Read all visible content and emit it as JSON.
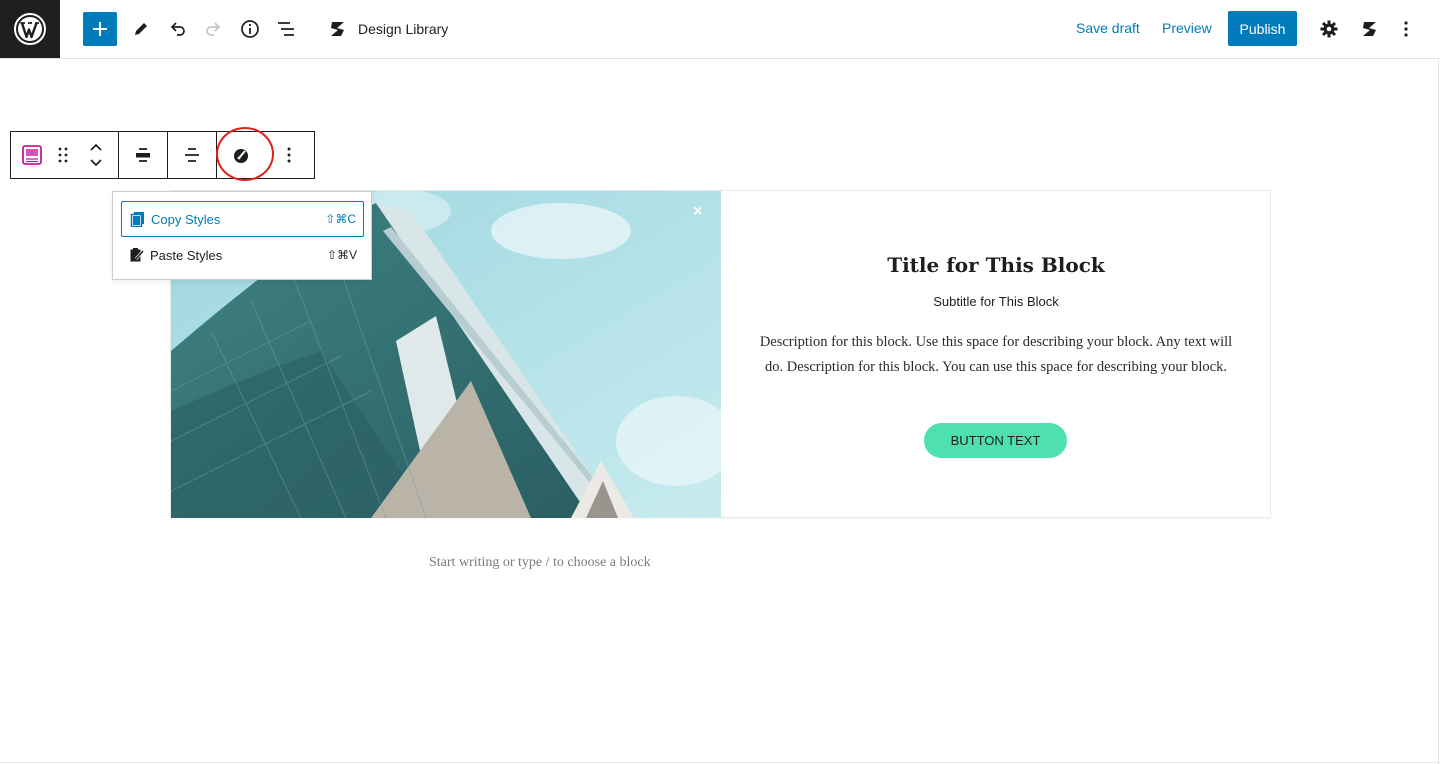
{
  "header": {
    "document_title": "Design Library",
    "save_draft": "Save draft",
    "preview": "Preview",
    "publish": "Publish"
  },
  "block_toolbar": {
    "icons": [
      "block-type-icon",
      "drag-handle-icon",
      "move-up-icon",
      "move-down-icon",
      "align-icon",
      "justify-icon",
      "styles-icon",
      "more-options-icon"
    ]
  },
  "styles_menu": {
    "items": [
      {
        "label": "Copy Styles",
        "shortcut": "⇧⌘C",
        "active": true
      },
      {
        "label": "Paste Styles",
        "shortcut": "⇧⌘V",
        "active": false
      }
    ]
  },
  "block": {
    "title": "Title for This Block",
    "subtitle": "Subtitle for This Block",
    "description": "Description for this block. Use this space for describing your block. Any text will do. Description for this block. You can use this space for describing your block.",
    "button_text": "BUTTON TEXT",
    "button_color": "#4fe0b0"
  },
  "editor": {
    "placeholder": "Start writing or type / to choose a block"
  },
  "colors": {
    "accent": "#007cba",
    "dark": "#1e1e1e",
    "annotation_ring": "#e0201a"
  }
}
